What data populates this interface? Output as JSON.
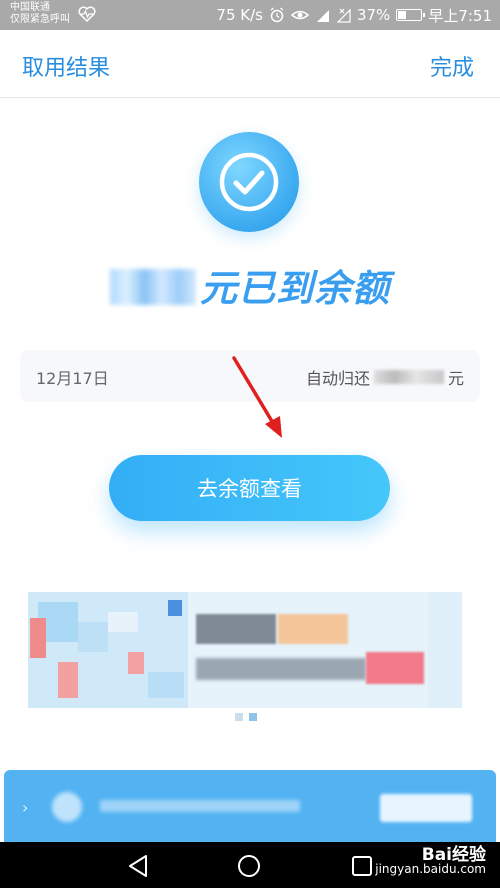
{
  "status_bar": {
    "carrier_line1": "中国联通",
    "carrier_line2": "仅限紧急呼叫",
    "speed": "75 K/s",
    "network": "4G",
    "battery": "37%",
    "battery_level": 0.37,
    "time": "早上7:51",
    "icons": [
      "heartbeat-icon",
      "alarm-icon",
      "eye-icon",
      "signal-icon",
      "no-signal-icon",
      "battery-icon"
    ]
  },
  "header": {
    "title": "取用结果",
    "done_label": "完成"
  },
  "result": {
    "icon": "check-icon",
    "amount_message": "元已到余额"
  },
  "info": {
    "date": "12月17日",
    "repay_label": "自动归还",
    "repay_suffix": "元"
  },
  "actions": {
    "view_balance_label": "去余额查看"
  },
  "carousel": {
    "page_count": 2,
    "active_index": 1
  },
  "nav": {
    "icons": [
      "back-triangle-icon",
      "home-circle-icon",
      "recents-square-icon"
    ]
  },
  "watermark": {
    "brand": "Bai经验",
    "url": "jingyan.baidu.com"
  },
  "colors": {
    "accent": "#2a8ee0",
    "button": "#3ab8f8",
    "status_bar": "#a9a9a9"
  }
}
